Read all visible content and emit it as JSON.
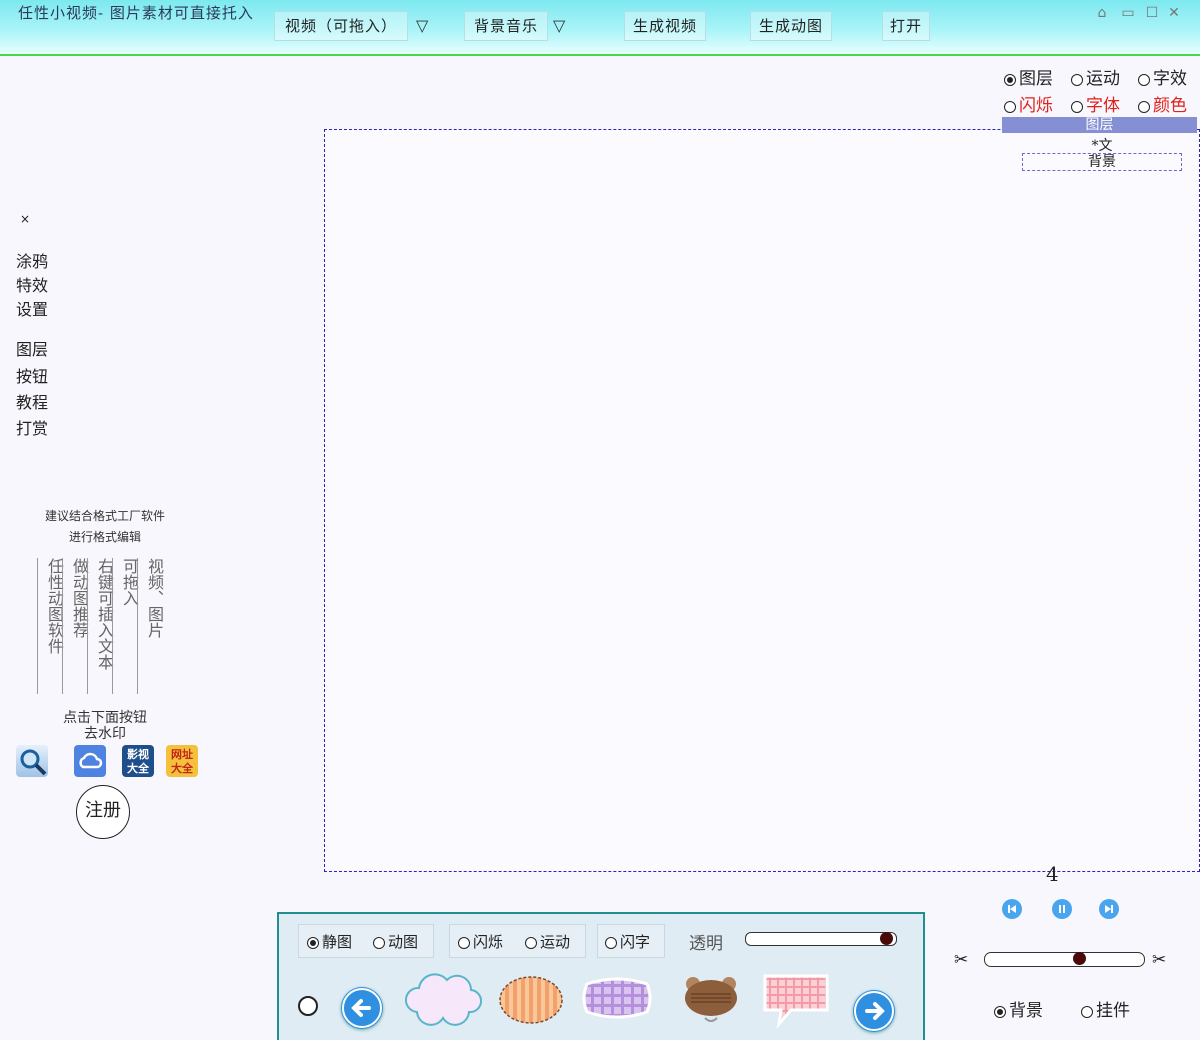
{
  "title": "任性小视频- 图片素材可直接托入",
  "toolbar": {
    "video": "视频（可拖入）",
    "bgm": "背景音乐",
    "gen_video": "生成视频",
    "gen_gif": "生成动图",
    "open": "打开",
    "dropdown_glyph": "▽"
  },
  "window_controls": {
    "home": "⌂",
    "restore": "▭",
    "max": "☐",
    "close": "✕"
  },
  "left": {
    "close": "×",
    "menu_a": [
      "涂鸦",
      "特效",
      "设置"
    ],
    "menu_b": [
      "图层",
      "按钮",
      "教程",
      "打赏"
    ],
    "note1": "建议结合格式工厂软件",
    "note2": "进行格式编辑",
    "columns": [
      "任性动图软件",
      "做动图推荐",
      "右键可插入文本",
      "可拖入",
      "视频、图片"
    ],
    "watermark1": "点击下面按钮",
    "watermark2": "去水印",
    "tiles": [
      {
        "icon": "magnifier-icon",
        "label": ""
      },
      {
        "icon": "cloud-icon",
        "label": ""
      },
      {
        "icon": "video-app-icon",
        "label": "影视大全"
      },
      {
        "icon": "web-app-icon",
        "label": "网址大全"
      }
    ],
    "register": "注册"
  },
  "right": {
    "radios_row1": [
      {
        "label": "图层",
        "selected": true,
        "color": "#222222"
      },
      {
        "label": "运动",
        "selected": false,
        "color": "#222222"
      },
      {
        "label": "字效",
        "selected": false,
        "color": "#222222"
      }
    ],
    "radios_row2": [
      {
        "label": "闪烁",
        "selected": false,
        "color": "#e0201a"
      },
      {
        "label": "字体",
        "selected": false,
        "color": "#e0201a"
      },
      {
        "label": "颜色",
        "selected": false,
        "color": "#e0201a"
      }
    ],
    "layer_header": "图层",
    "layer_items": [
      "*文",
      "背景"
    ],
    "frame_number": "4",
    "bottom_radios": [
      {
        "label": "背景",
        "selected": true
      },
      {
        "label": "挂件",
        "selected": false
      }
    ],
    "slider_value": 0.6,
    "scissors": "✂"
  },
  "bottom": {
    "still": "静图",
    "animated": "动图",
    "flash": "闪烁",
    "motion": "运动",
    "flash_text": "闪字",
    "transparency": "透明",
    "transparency_value": 0.98
  },
  "colors": {
    "accent": "#2b24c4",
    "panel_border": "#238e8e",
    "layer_header_bg": "#8590d4"
  }
}
